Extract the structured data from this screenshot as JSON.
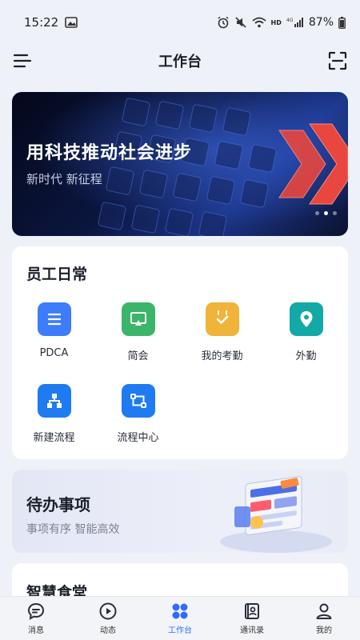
{
  "status_bar": {
    "time": "15:22",
    "battery": "87%",
    "network": "HD",
    "signal": "4G"
  },
  "header": {
    "title": "工作台"
  },
  "banner": {
    "title": "用科技推动社会进步",
    "subtitle": "新时代 新征程",
    "slides": 3,
    "active_slide": 2
  },
  "daily": {
    "title": "员工日常",
    "apps": [
      {
        "label": "PDCA",
        "icon": "list-icon",
        "color": "#3d7dfc"
      },
      {
        "label": "简会",
        "icon": "presentation-icon",
        "color": "#3bb56a"
      },
      {
        "label": "我的考勤",
        "icon": "calendar-check-icon",
        "color": "#f0b43a"
      },
      {
        "label": "外勤",
        "icon": "location-pin-icon",
        "color": "#12a9a6"
      },
      {
        "label": "新建流程",
        "icon": "org-chart-icon",
        "color": "#1f7bf2"
      },
      {
        "label": "流程中心",
        "icon": "flow-icon",
        "color": "#1f7bf2"
      }
    ]
  },
  "todo": {
    "title": "待办事项",
    "subtitle": "事项有序 智能高效"
  },
  "canteen": {
    "title": "智慧食堂"
  },
  "bottom_nav": {
    "accent": "#2f6bff",
    "items": [
      {
        "label": "消息",
        "icon": "message-icon"
      },
      {
        "label": "动态",
        "icon": "play-circle-icon"
      },
      {
        "label": "工作台",
        "icon": "workbench-icon"
      },
      {
        "label": "通讯录",
        "icon": "contacts-icon"
      },
      {
        "label": "我的",
        "icon": "profile-icon"
      }
    ],
    "active_index": 2
  }
}
